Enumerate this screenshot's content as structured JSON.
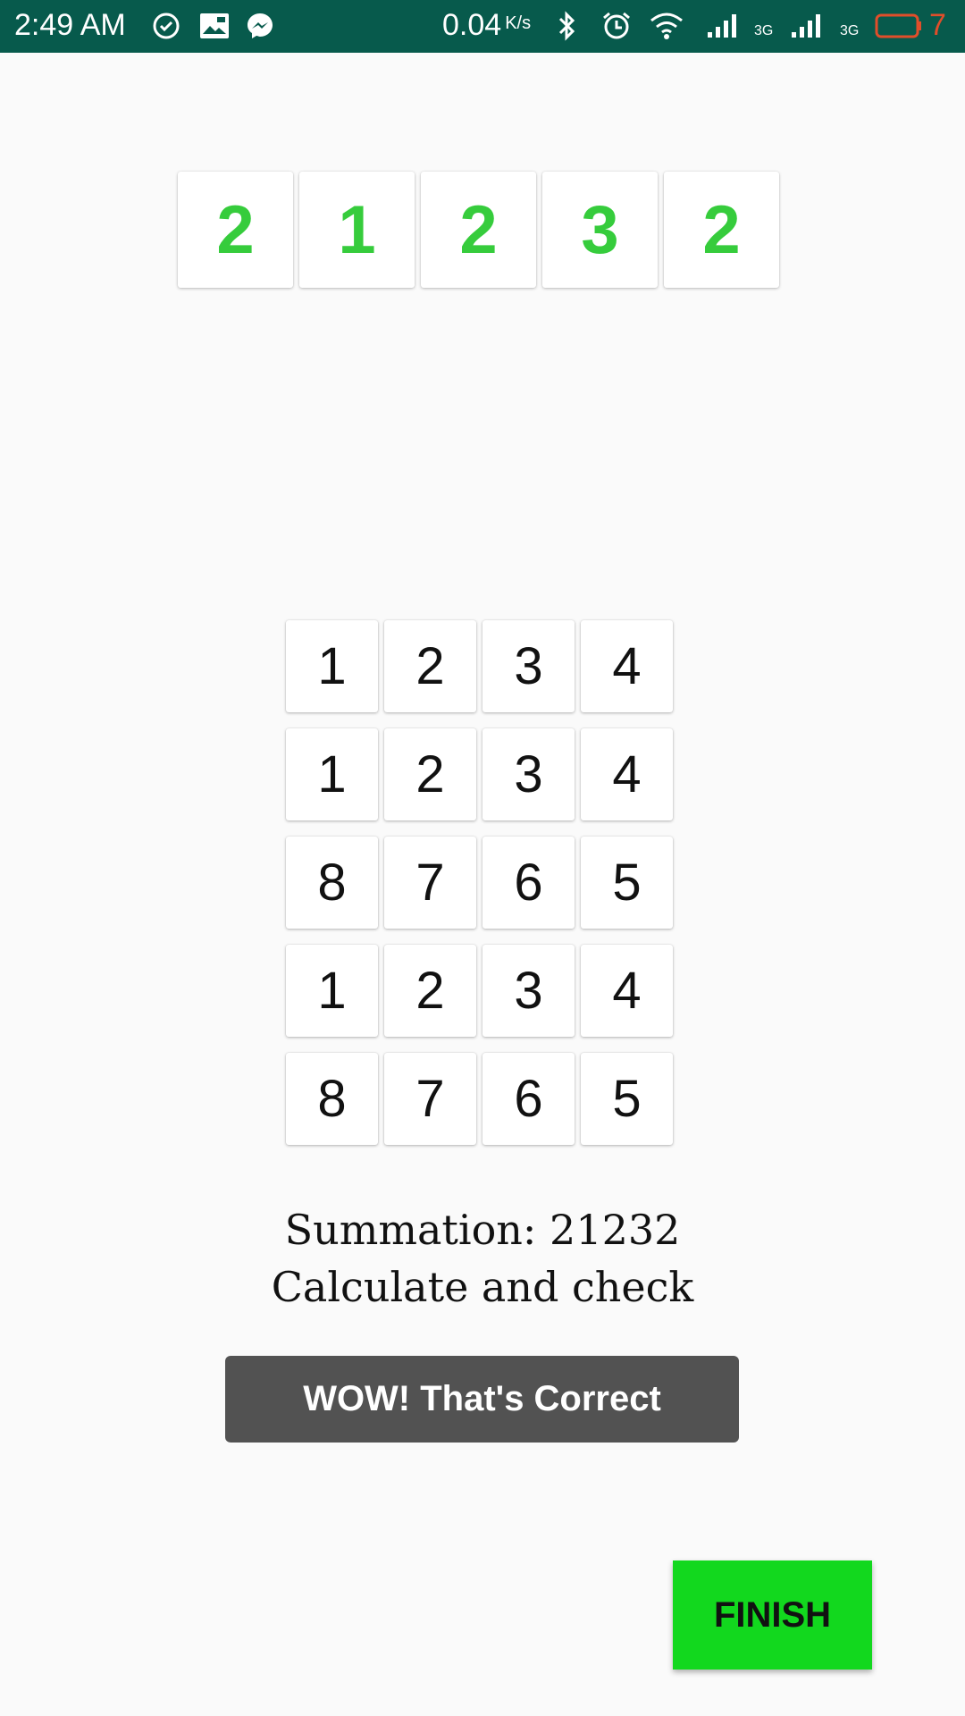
{
  "status_bar": {
    "time": "2:49 AM",
    "speed": "0.04",
    "speed_unit": "K/s",
    "network_1": "3G",
    "network_2": "3G",
    "battery": "7",
    "icons": [
      "check-circle-icon",
      "gallery-icon",
      "messenger-icon",
      "bluetooth-icon",
      "alarm-icon",
      "wifi-icon",
      "signal-icon",
      "signal-icon",
      "battery-icon"
    ],
    "colors": {
      "background": "#075a4c",
      "battery_text": "#e04e2a"
    }
  },
  "target_digits": [
    "2",
    "1",
    "2",
    "3",
    "2"
  ],
  "grid": {
    "rows": [
      [
        "1",
        "2",
        "3",
        "4"
      ],
      [
        "1",
        "2",
        "3",
        "4"
      ],
      [
        "8",
        "7",
        "6",
        "5"
      ],
      [
        "1",
        "2",
        "3",
        "4"
      ],
      [
        "8",
        "7",
        "6",
        "5"
      ]
    ]
  },
  "summary": {
    "summation": "Summation: 21232",
    "instruction": "Calculate and check"
  },
  "result_button": {
    "label": "WOW! That's Correct"
  },
  "finish_button": {
    "label": "FINISH"
  },
  "colors": {
    "digit_green": "#36cc3c",
    "finish_green": "#12d81e",
    "result_button_bg": "#525252"
  }
}
